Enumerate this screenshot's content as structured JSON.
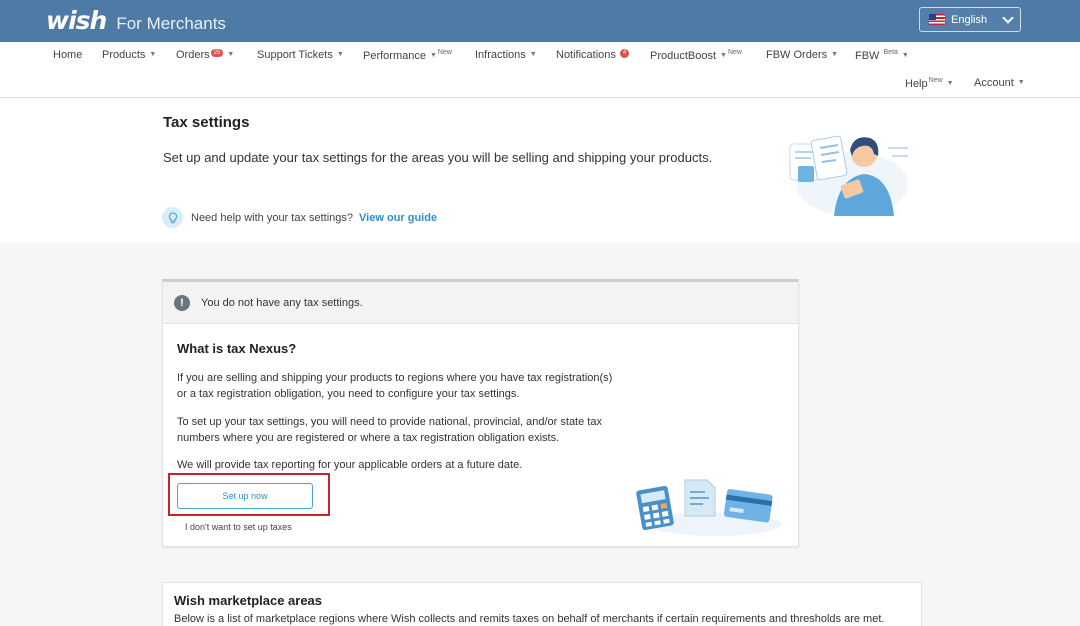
{
  "brand": {
    "logo_text": "wish",
    "subtitle": "For Merchants"
  },
  "language": {
    "label": "English"
  },
  "nav": {
    "home": "Home",
    "products": "Products",
    "orders": "Orders",
    "orders_badge": "25",
    "support": "Support Tickets",
    "performance": "Performance",
    "performance_tag": "New",
    "infractions": "Infractions",
    "notifications": "Notifications",
    "notifications_badge": "4",
    "productboost": "ProductBoost",
    "productboost_tag": "New",
    "fbw_orders": "FBW Orders",
    "fbw": "FBW",
    "fbw_tag": "Beta",
    "help": "Help",
    "help_tag": "New",
    "account": "Account"
  },
  "header": {
    "title": "Tax settings",
    "description": "Set up and update your tax settings for the areas you will be selling and shipping your products.",
    "help_text": "Need help with your tax settings?",
    "help_link": "View our guide"
  },
  "tax_card": {
    "notice": "You do not have any tax settings.",
    "title": "What is tax Nexus?",
    "para1": "If you are selling and shipping your products to regions where you have tax registration(s) or a tax registration obligation, you need to configure your tax settings.",
    "para2": "To set up your tax settings, you will need to provide national, provincial, and/or state tax numbers where you are registered or where a tax registration obligation exists.",
    "para3": "We will provide tax reporting for your applicable orders at a future date.",
    "setup_button": "Set up now",
    "decline_link": "I don't want to set up taxes"
  },
  "marketplace": {
    "title": "Wish marketplace areas",
    "description": "Below is a list of marketplace regions where Wish collects and remits taxes on behalf of merchants if certain requirements and thresholds are met."
  }
}
